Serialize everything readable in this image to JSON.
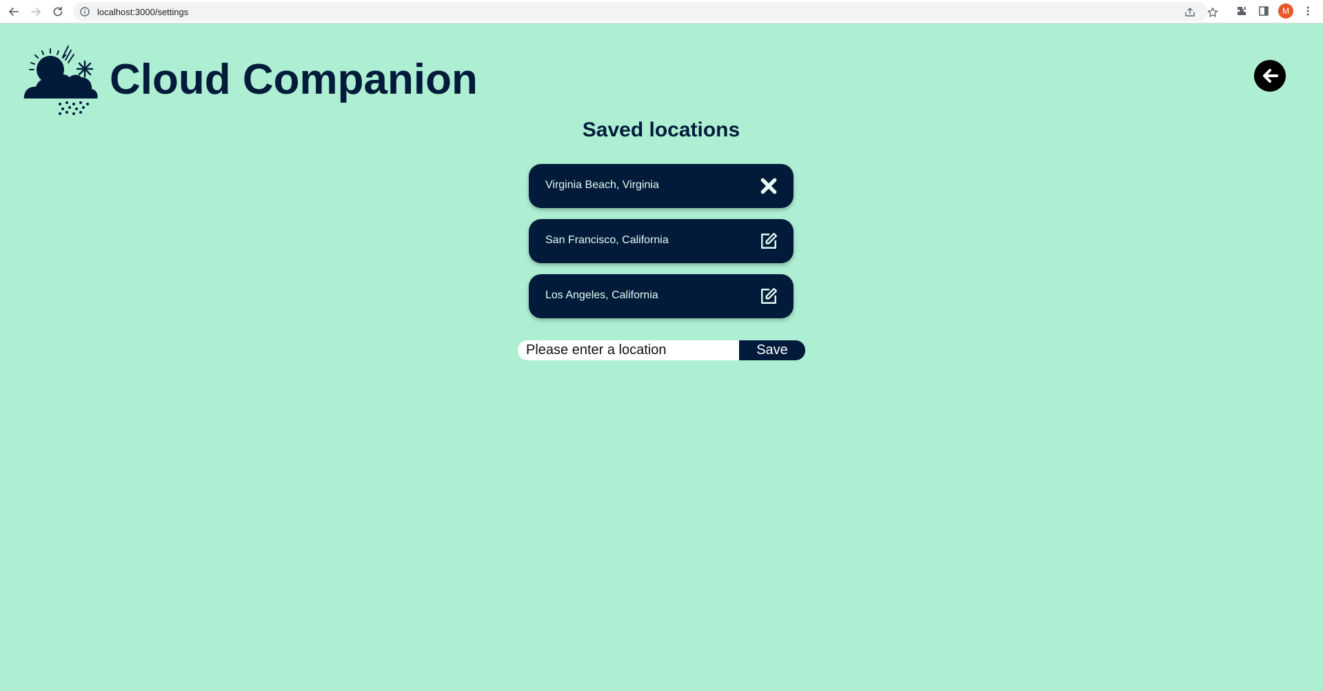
{
  "browser": {
    "url": "localhost:3000/settings",
    "avatar_letter": "M",
    "icons": [
      "back-arrow-icon",
      "forward-arrow-icon",
      "reload-icon",
      "info-icon",
      "share-icon",
      "star-icon",
      "extensions-icon",
      "side-panel-icon",
      "menu-dots-icon"
    ]
  },
  "header": {
    "title": "Cloud Companion",
    "logo_icon": "weather-logo-icon",
    "back_icon": "arrow-left-icon"
  },
  "saved": {
    "title": "Saved locations",
    "items": [
      {
        "label": "Virginia Beach, Virginia",
        "action_icon": "close-icon"
      },
      {
        "label": "San Francisco, California",
        "action_icon": "edit-icon"
      },
      {
        "label": "Los Angeles, California",
        "action_icon": "edit-icon"
      }
    ]
  },
  "form": {
    "placeholder": "Please enter a location",
    "value": "",
    "save_label": "Save"
  },
  "colors": {
    "background": "#aeefd3",
    "primary": "#021b3a",
    "card_text": "#e6fbf2"
  }
}
